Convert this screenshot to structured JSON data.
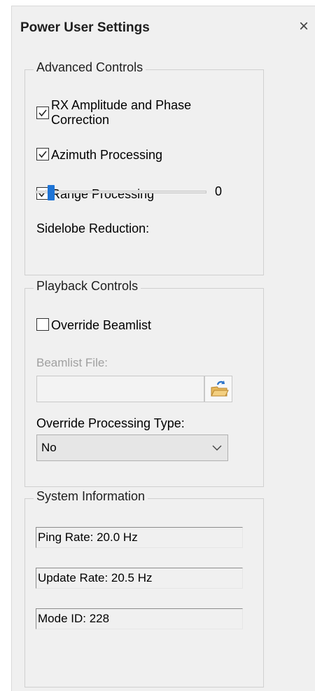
{
  "window": {
    "title": "Power User Settings"
  },
  "advanced": {
    "title": "Advanced Controls",
    "checkboxes": [
      {
        "label_line1": "RX Amplitude and Phase",
        "label_line2": "Correction",
        "checked": true
      },
      {
        "label": "Azimuth Processing",
        "checked": true
      },
      {
        "label": "Range Processing",
        "checked": true
      }
    ],
    "sidelobe": {
      "label": "Sidelobe Reduction:",
      "value": "0",
      "level": 0
    }
  },
  "playback": {
    "title": "Playback Controls",
    "override_beamlist": {
      "label": "Override Beamlist",
      "checked": false
    },
    "beamlist_file": {
      "label": "Beamlist File:",
      "value": ""
    },
    "processing_type": {
      "label": "Override Processing Type:",
      "selected": "No"
    }
  },
  "system": {
    "title": "System Information",
    "ping_rate": "Ping Rate: 20.0 Hz",
    "update_rate": "Update Rate: 20.5 Hz",
    "mode_id": "Mode ID: 228"
  },
  "colors": {
    "accent": "#1e74d6",
    "panel_bg": "#f0f0f0",
    "disabled_text": "#a0a0a0"
  }
}
